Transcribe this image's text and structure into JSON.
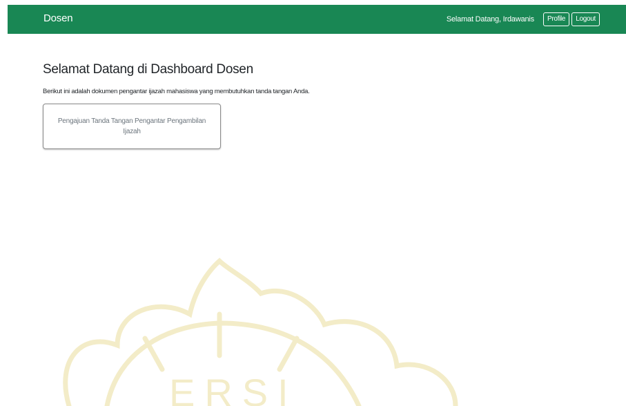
{
  "navbar": {
    "brand": "Dosen",
    "welcome": "Selamat Datang, Irdawanis",
    "profile_label": "Profile",
    "logout_label": "Logout",
    "color": "#198754"
  },
  "main": {
    "title": "Selamat Datang di Dashboard Dosen",
    "description": "Berikut ini adalah dokumen pengantar ijazah mahasiswa yang membutuhkan tanda tangan Anda.",
    "card_label": "Pengajuan Tanda Tangan Pengantar Pengambilan Ijazah"
  },
  "watermark": {
    "text": "ERSI",
    "color": "#f3ecc8"
  }
}
